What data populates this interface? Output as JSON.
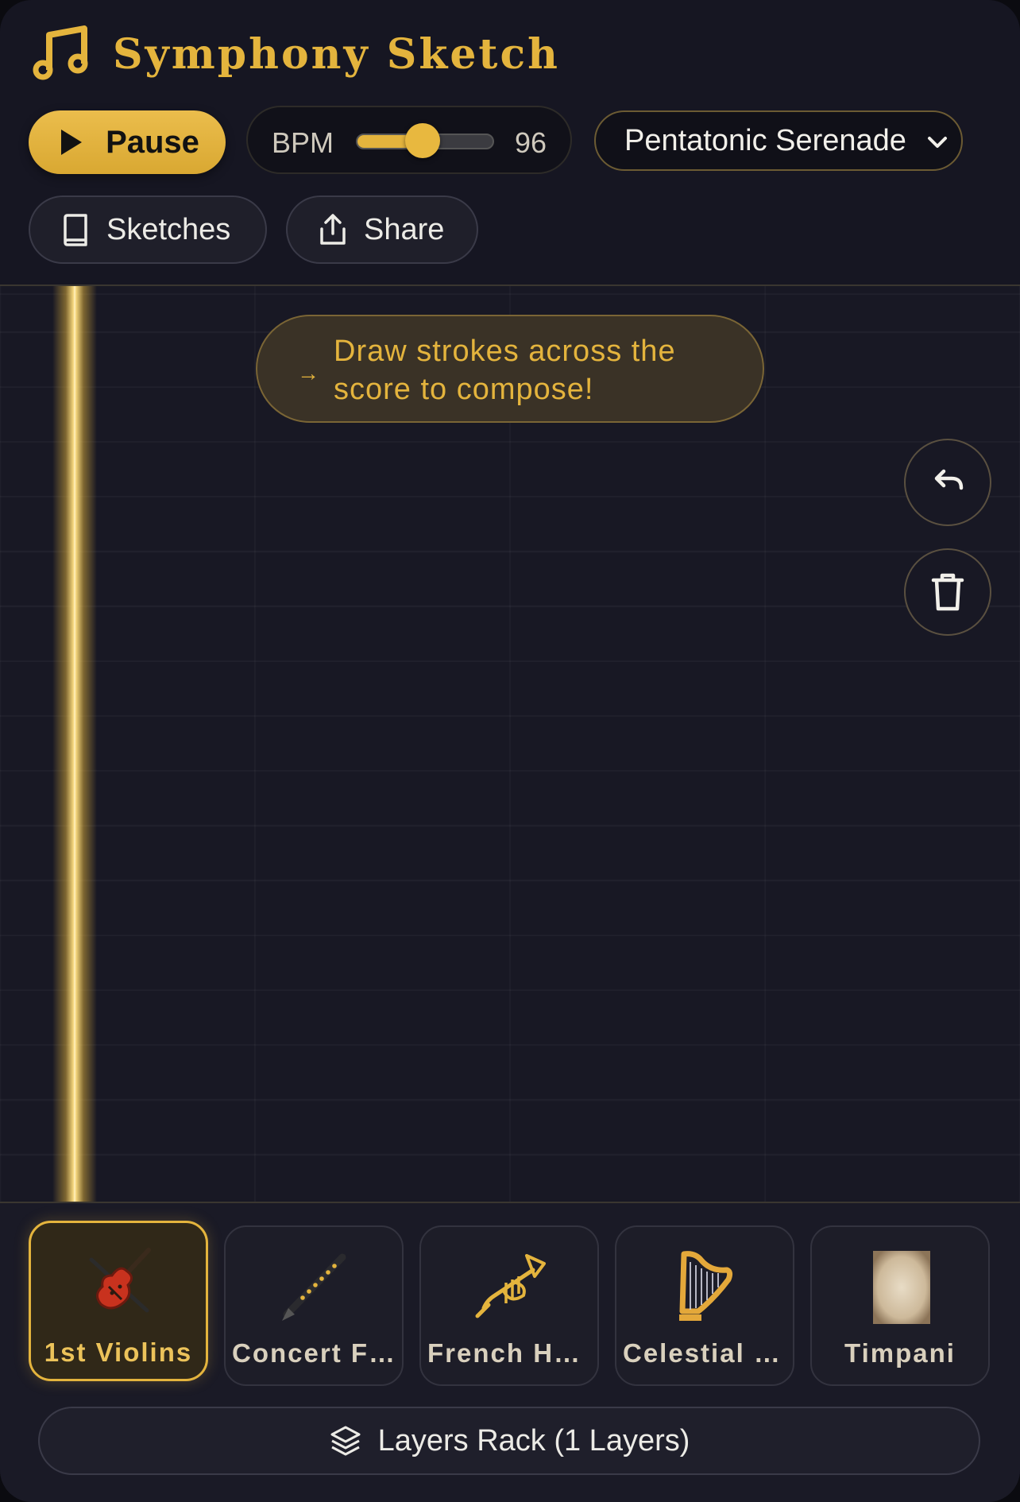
{
  "app": {
    "title": "Symphony Sketch"
  },
  "toolbar": {
    "play_label": "Pause",
    "bpm_label": "BPM",
    "bpm_value": "96",
    "bpm_level": 0.48,
    "preset_selected": "Pentatonic Serenade",
    "sketches_label": "Sketches",
    "share_label": "Share"
  },
  "canvas": {
    "hint_arrow": "→",
    "hint_text": "Draw strokes across the score to compose!"
  },
  "instruments": [
    {
      "label": "1st Violins",
      "icon": "violin-icon",
      "active": true
    },
    {
      "label": "Concert Flute",
      "icon": "flute-icon",
      "active": false
    },
    {
      "label": "French Horn",
      "icon": "horn-icon",
      "active": false
    },
    {
      "label": "Celestial Harp",
      "icon": "harp-icon",
      "active": false
    },
    {
      "label": "Timpani",
      "icon": "parchment-icon",
      "active": false
    }
  ],
  "layers": {
    "label": "Layers Rack (1 Layers)"
  },
  "colors": {
    "accent": "#e4b43d",
    "background": "#15151f"
  }
}
